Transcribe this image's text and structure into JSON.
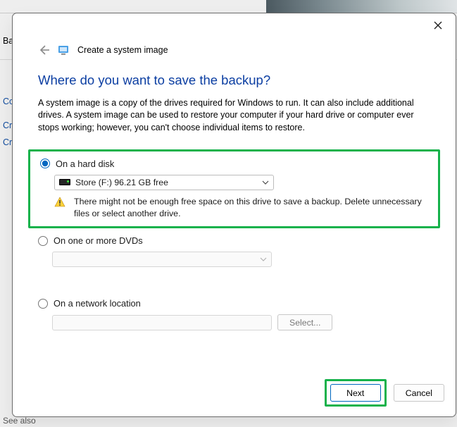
{
  "behind": {
    "ba": "Ba",
    "co": "Co",
    "cr1": "Cr",
    "cr2": "Cr",
    "see": "See also"
  },
  "window": {
    "title": "Create a system image",
    "heading": "Where do you want to save the backup?",
    "description": "A system image is a copy of the drives required for Windows to run. It can also include additional drives. A system image can be used to restore your computer if your hard drive or computer ever stops working; however, you can't choose individual items to restore.",
    "option1": {
      "label": "On a hard disk",
      "drive": "Store (F:)  96.21 GB free",
      "warning": "There might not be enough free space on this drive to save a backup. Delete unnecessary files or select another drive."
    },
    "option2": {
      "label": "On one or more DVDs"
    },
    "option3": {
      "label": "On a network location",
      "select": "Select..."
    },
    "footer": {
      "next": "Next",
      "cancel": "Cancel"
    }
  }
}
